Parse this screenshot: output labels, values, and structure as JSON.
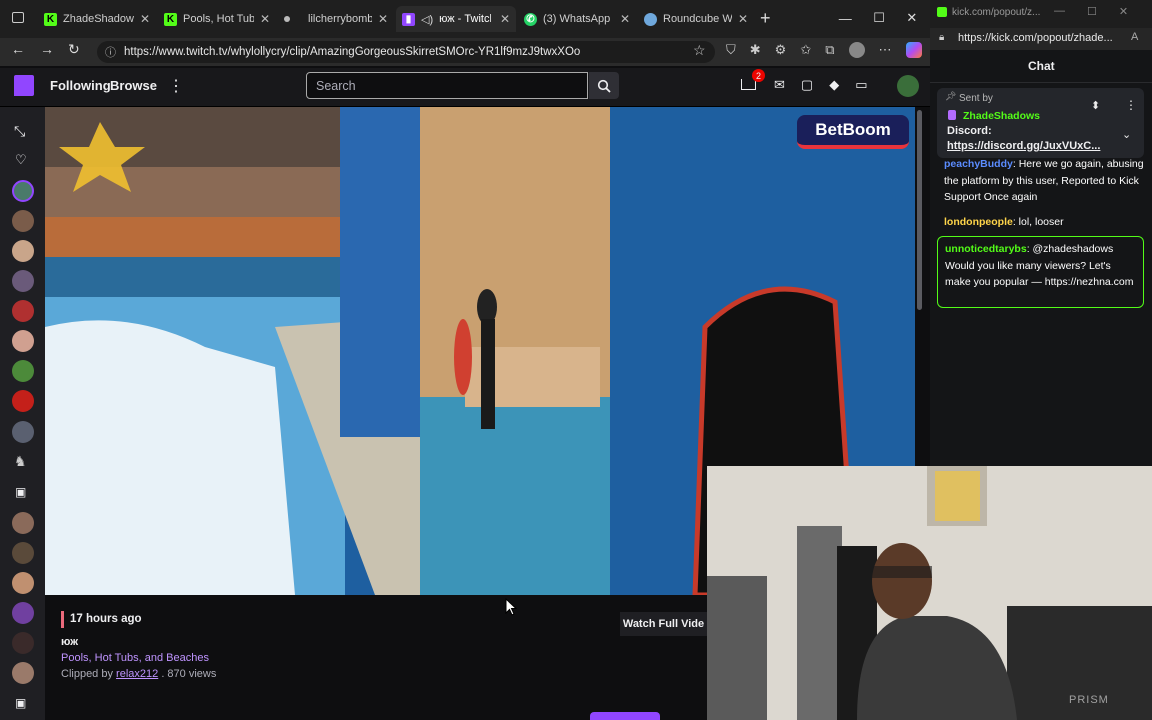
{
  "browser": {
    "tabs": [
      {
        "label": "ZhadeShadows S"
      },
      {
        "label": "Pools, Hot Tubs"
      },
      {
        "label": "lilcherrybomb C"
      },
      {
        "label": "юж - Twitch"
      },
      {
        "label": "(3) WhatsApp"
      },
      {
        "label": "Roundcube Web"
      }
    ],
    "new_tab": "+",
    "url": "https://www.twitch.tv/whylollycry/clip/AmazingGorgeousSkirretSMOrc-YR1lf9mzJ9twxXOo"
  },
  "twitch": {
    "nav": {
      "following": "Following",
      "browse": "Browse",
      "more": "⋮",
      "notification_count": "2"
    },
    "search": {
      "placeholder": "Search"
    },
    "video": {
      "watermark": "BetBoom"
    },
    "clip": {
      "time_ago": "17 hours ago",
      "title": "юж",
      "category": "Pools, Hot Tubs, and Beaches",
      "clipped_by_prefix": "Clipped by",
      "clipper": "relax212",
      "views": ". 870 views",
      "watch_full": "Watch Full Vide"
    }
  },
  "kick": {
    "window_url_short": "kick.com/popout/z...",
    "url": "https://kick.com/popout/zhade...",
    "chat_title": "Chat",
    "pinned": {
      "label": "Sent by",
      "user": "ZhadeShadows",
      "text_label": "Discord:",
      "link": "https://discord.gg/JuxVUxC..."
    },
    "messages": [
      {
        "user": "peachyBuddy",
        "color": "#5b8cff",
        "text": ": Here we go again, abusing the platform by this user, Reported to Kick Support Once again"
      },
      {
        "user": "londonpeople",
        "color": "#ffd54a",
        "text": ": lol, looser"
      },
      {
        "user": "unnoticedtarybs",
        "color": "#53fc18",
        "text": ": @zhadeshadows Would you like many viewers? Let's make you popular — https://nezhna.com"
      }
    ]
  },
  "webcam": {
    "overlay_text": "PRISM"
  }
}
